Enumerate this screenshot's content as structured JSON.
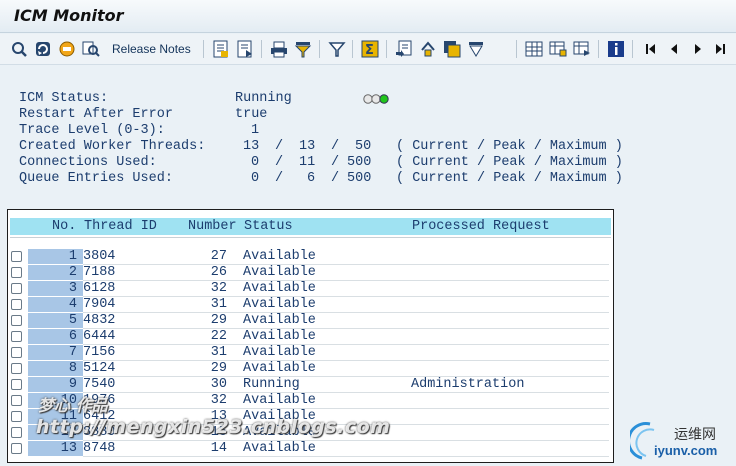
{
  "window": {
    "title": "ICM Monitor"
  },
  "toolbar": {
    "release_notes_label": "Release Notes",
    "icons_left": [
      "refresh-icon",
      "reload-icon",
      "stop-icon",
      "search-icon"
    ],
    "icons_right": [
      "details-icon",
      "detail-list-icon",
      "print-icon",
      "filter-icon",
      "filter-set-icon",
      "sum-icon",
      "export-icon",
      "import-icon",
      "save-icon",
      "sort-icon",
      "layout-icon",
      "change-layout-icon",
      "select-layout-icon",
      "info-icon",
      "first-page-icon",
      "previous-page-icon",
      "next-page-icon",
      "last-page-icon"
    ]
  },
  "status_info": {
    "icm_status": {
      "label": "ICM Status:",
      "value": "Running"
    },
    "restart_after_error": {
      "label": "Restart After Error",
      "value": "true"
    },
    "trace_level": {
      "label": "Trace Level (0-3):",
      "value": "1"
    },
    "created_worker_threads": {
      "label": "Created Worker Threads:",
      "current": "13",
      "peak": "13",
      "maximum": "50",
      "legend": "( Current / Peak / Maximum )"
    },
    "connections_used": {
      "label": "Connections Used:",
      "current": "0",
      "peak": "11",
      "maximum": "500",
      "legend": "( Current / Peak / Maximum )"
    },
    "queue_entries_used": {
      "label": "Queue Entries Used:",
      "current": "0",
      "peak": "6",
      "maximum": "500",
      "legend": "( Current / Peak / Maximum )"
    },
    "separator": "/",
    "traffic_light": {
      "red": "#e8e8e8",
      "yellow": "#e8e8e8",
      "green": "#21c51d"
    }
  },
  "table": {
    "headers": {
      "no": "No.",
      "thread_id": "Thread ID",
      "number": "Number",
      "status": "Status",
      "processed_request": "Processed Request"
    },
    "rows": [
      {
        "no": "1",
        "thread_id": "3804",
        "number": "27",
        "status": "Available",
        "processed_request": ""
      },
      {
        "no": "2",
        "thread_id": "7188",
        "number": "26",
        "status": "Available",
        "processed_request": ""
      },
      {
        "no": "3",
        "thread_id": "6128",
        "number": "32",
        "status": "Available",
        "processed_request": ""
      },
      {
        "no": "4",
        "thread_id": "7904",
        "number": "31",
        "status": "Available",
        "processed_request": ""
      },
      {
        "no": "5",
        "thread_id": "4832",
        "number": "29",
        "status": "Available",
        "processed_request": ""
      },
      {
        "no": "6",
        "thread_id": "6444",
        "number": "22",
        "status": "Available",
        "processed_request": ""
      },
      {
        "no": "7",
        "thread_id": "7156",
        "number": "31",
        "status": "Available",
        "processed_request": ""
      },
      {
        "no": "8",
        "thread_id": "5124",
        "number": "29",
        "status": "Available",
        "processed_request": ""
      },
      {
        "no": "9",
        "thread_id": "7540",
        "number": "30",
        "status": "Running",
        "processed_request": "Administration"
      },
      {
        "no": "10",
        "thread_id": "1976",
        "number": "32",
        "status": "Available",
        "processed_request": ""
      },
      {
        "no": "11",
        "thread_id": "6412",
        "number": "13",
        "status": "Available",
        "processed_request": ""
      },
      {
        "no": "12",
        "thread_id": "8880",
        "number": "15",
        "status": "Available",
        "processed_request": ""
      },
      {
        "no": "13",
        "thread_id": "8748",
        "number": "14",
        "status": "Available",
        "processed_request": ""
      }
    ]
  },
  "watermark": {
    "line1": "梦心 作品",
    "line2": "http://mengxin523.cnblogs.com",
    "site_name": "运维网",
    "site_url": "iyunv.com"
  }
}
